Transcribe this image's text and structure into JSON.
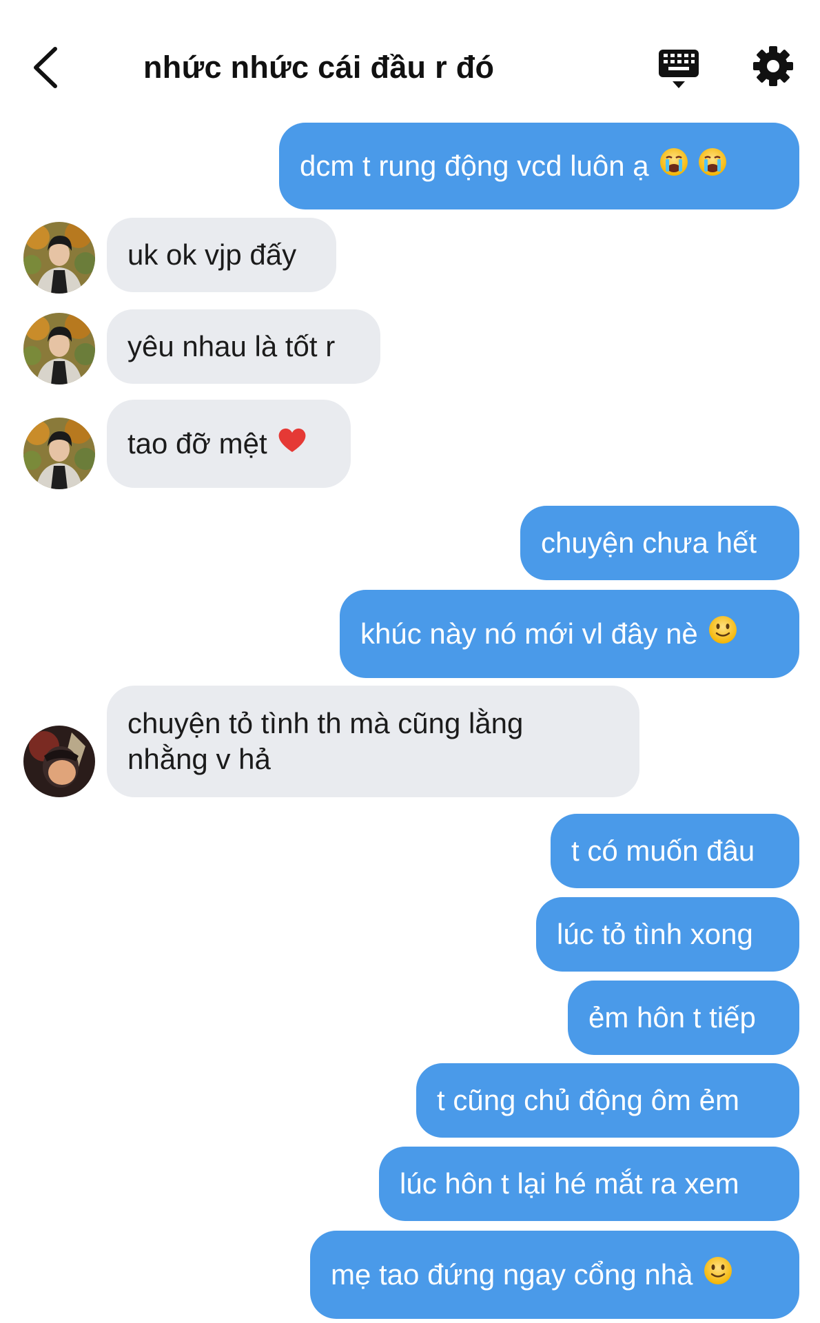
{
  "header": {
    "title": "nhức nhức cái đầu r đó",
    "back_icon": "chevron-left-icon",
    "keyboard_icon": "keyboard-icon",
    "settings_icon": "gear-icon"
  },
  "colors": {
    "outgoing_bubble": "#4a9ae9",
    "incoming_bubble": "#e9ebef",
    "background": "#ffffff"
  },
  "messages": [
    {
      "direction": "out",
      "text": "dcm t rung động vcd luôn ạ",
      "emoji": [
        "loudly-crying-face-icon",
        "loudly-crying-face-icon"
      ]
    },
    {
      "direction": "in",
      "text": "uk ok vjp đấy",
      "avatar": "avatar-person-1"
    },
    {
      "direction": "in",
      "text": "yêu nhau là tốt r",
      "avatar": "avatar-person-1"
    },
    {
      "direction": "in",
      "text": "tao đỡ mệt",
      "emoji": [
        "red-heart-icon"
      ],
      "avatar": "avatar-person-1"
    },
    {
      "direction": "out",
      "text": "chuyện chưa hết"
    },
    {
      "direction": "out",
      "text": "khúc này nó mới vl đây nè",
      "emoji": [
        "slightly-smiling-face-icon"
      ]
    },
    {
      "direction": "in",
      "text": "chuyện tỏ tình th mà cũng lằng nhằng v hả",
      "avatar": "avatar-person-2"
    },
    {
      "direction": "out",
      "text": "t có muốn đâu"
    },
    {
      "direction": "out",
      "text": "lúc tỏ tình xong"
    },
    {
      "direction": "out",
      "text": "ẻm hôn t tiếp"
    },
    {
      "direction": "out",
      "text": "t cũng chủ động ôm ẻm"
    },
    {
      "direction": "out",
      "text": "lúc hôn t lại hé mắt ra xem"
    },
    {
      "direction": "out",
      "text": "mẹ tao đứng ngay cổng nhà",
      "emoji": [
        "slightly-smiling-face-icon"
      ]
    }
  ]
}
